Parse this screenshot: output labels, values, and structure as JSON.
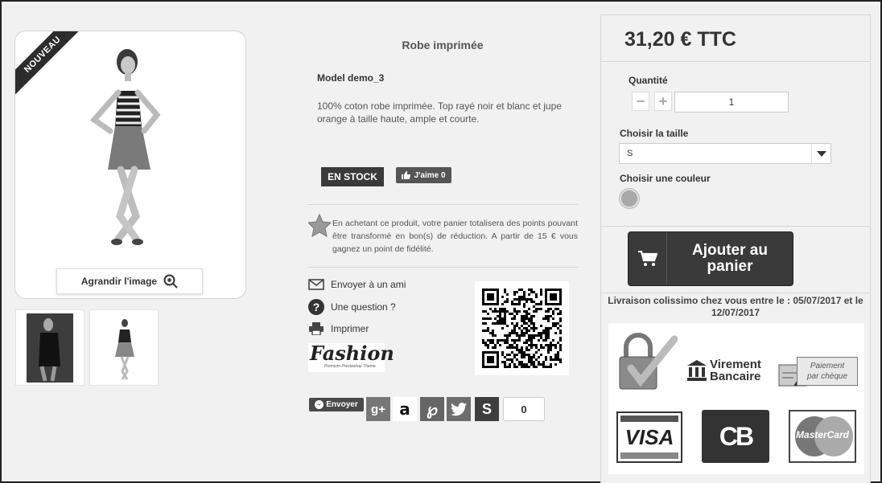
{
  "product": {
    "badge": "NOUVEAU",
    "title": "Robe imprimée",
    "reference": "Model demo_3",
    "description": "100% coton robe imprimée. Top rayé noir et blanc et jupe orange à taille haute, ample et courte.",
    "stock_label": "EN STOCK",
    "like_label": "J'aime 0",
    "zoom_label": "Agrandir l'image",
    "loyalty_text": "En achetant ce produit, votre panier totalisera des points pouvant être transformé en bon(s) de réduction. A partir de 15 € vous gagnez un point de fidélité."
  },
  "links": {
    "send_friend": "Envoyer à un ami",
    "question": "Une question ?",
    "print": "Imprimer"
  },
  "brand": {
    "name": "Fashion",
    "tagline": "Premium Prestashop Theme"
  },
  "share": {
    "send_label": "Envoyer",
    "count": "0",
    "networks": [
      "g+",
      "amazon",
      "pinterest",
      "twitter",
      "stumbleupon"
    ]
  },
  "buy": {
    "price": "31,20 € TTC",
    "quantity_label": "Quantité",
    "quantity_value": "1",
    "size_label": "Choisir la taille",
    "size_value": "S",
    "color_label": "Choisir une couleur",
    "color_value": "#a9a9a9",
    "cart_label": "Ajouter au panier",
    "delivery": "Livraison colissimo chez vous entre le : 05/07/2017 et le 12/07/2017"
  },
  "payments": {
    "transfer_line1": "Virement",
    "transfer_line2": "Bancaire",
    "cheque_line1": "Paiement",
    "cheque_line2": "par chèque",
    "visa": "VISA",
    "cb": "CB",
    "mastercard": "MasterCard"
  }
}
